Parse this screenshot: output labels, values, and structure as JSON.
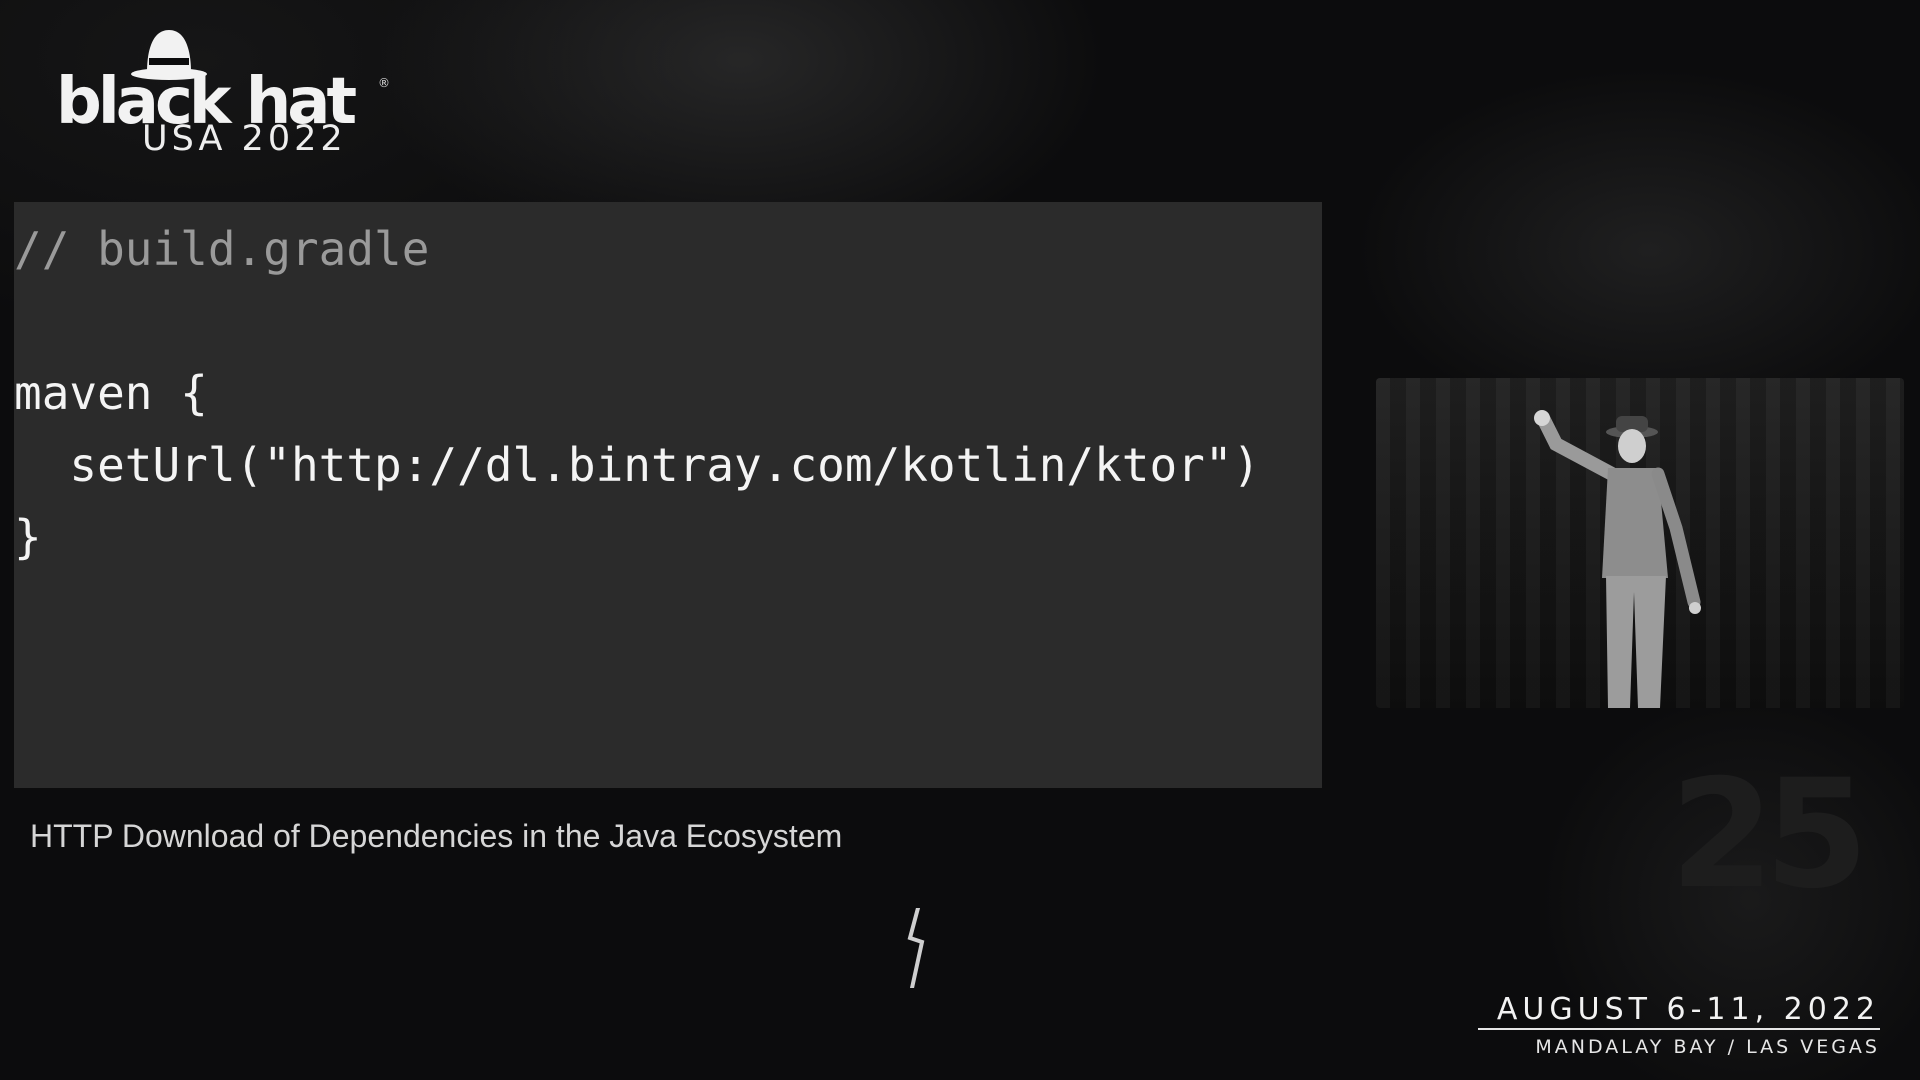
{
  "brand": {
    "wordmark": "black hat",
    "registered": "®",
    "edition": "USA 2022",
    "icon": "spy-hat-icon"
  },
  "slide": {
    "code_lines": [
      "// build.gradle",
      "",
      "maven {",
      "  setUrl(\"http://dl.bintray.com/kotlin/ktor\")",
      "}"
    ],
    "caption": "HTTP Download of Dependencies in the Java Ecosystem"
  },
  "event": {
    "dates": "AUGUST 6-11, 2022",
    "venue": "MANDALAY BAY / LAS VEGAS"
  },
  "watermark": "25",
  "colors": {
    "background": "#0c0c0d",
    "code_panel": "#2b2b2b",
    "code_text": "#f4f4f4",
    "code_comment": "#9a9a9a",
    "caption_text": "#d6d6d6"
  }
}
